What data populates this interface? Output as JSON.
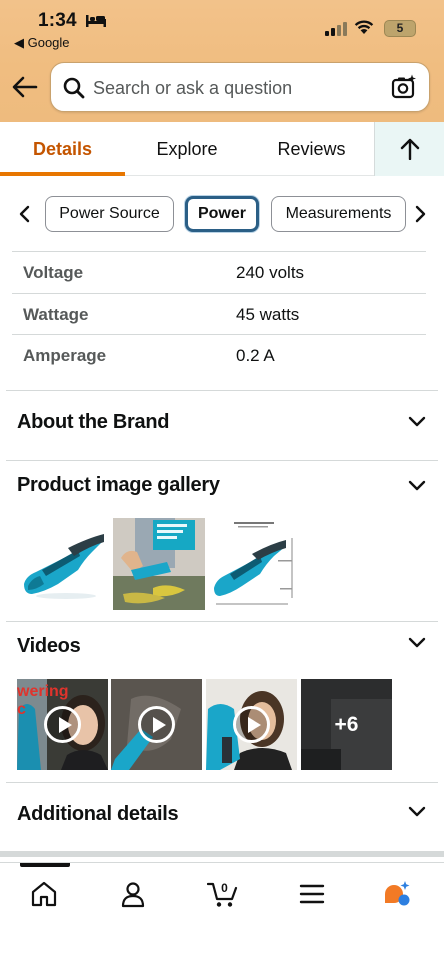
{
  "status_bar": {
    "time": "1:34",
    "back_app": "◀ Google",
    "battery": "5"
  },
  "search": {
    "placeholder": "Search or ask a question"
  },
  "tabs": [
    {
      "label": "Details",
      "active": true
    },
    {
      "label": "Explore",
      "active": false
    },
    {
      "label": "Reviews",
      "active": false
    }
  ],
  "chips": [
    {
      "label": "Power Source",
      "selected": false
    },
    {
      "label": "Power",
      "selected": true
    },
    {
      "label": "Measurements",
      "selected": false
    }
  ],
  "specs": [
    {
      "label": "Voltage",
      "value": "240 volts"
    },
    {
      "label": "Wattage",
      "value": "45 watts"
    },
    {
      "label": "Amperage",
      "value": "0.2 A"
    }
  ],
  "sections": {
    "about_brand": "About the Brand",
    "gallery": "Product image gallery",
    "videos": "Videos",
    "additional": "Additional details"
  },
  "videos": {
    "caption": "wering",
    "caption2": "c",
    "more": "+6"
  },
  "colors": {
    "header": "#f0bd80",
    "accent": "#e77600",
    "active_tab": "#c45500",
    "chip_selected": "#2b5f86",
    "vacuum_teal": "#1aa6c9"
  },
  "bottom_nav": {
    "icons": [
      "home-icon",
      "profile-icon",
      "cart-icon",
      "menu-icon",
      "rufus-icon"
    ],
    "cart_count": "0"
  }
}
